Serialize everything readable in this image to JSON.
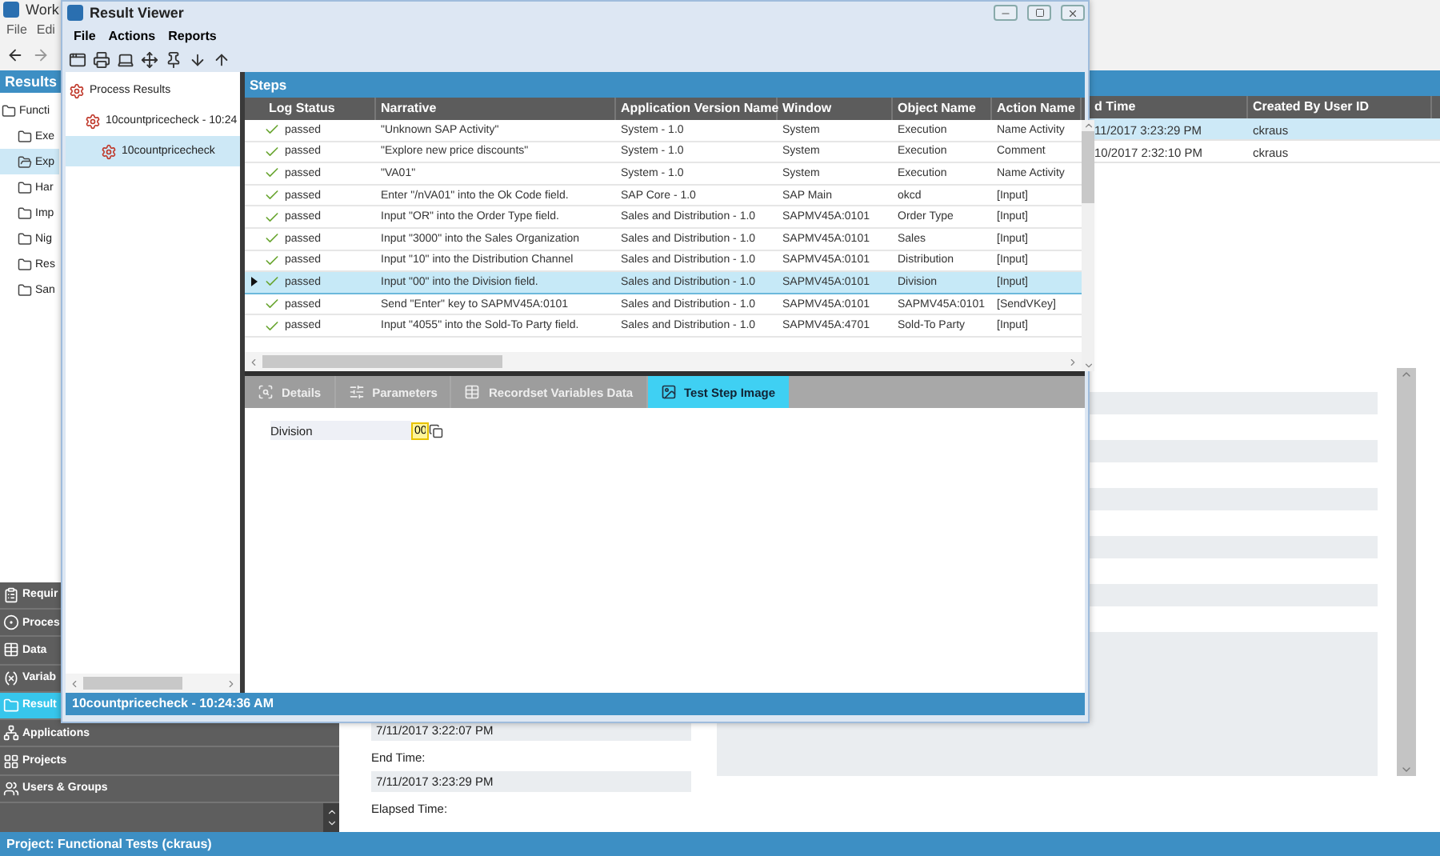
{
  "app": {
    "title": "Work",
    "menu": [
      "File",
      "Edi"
    ]
  },
  "results_panel": {
    "title": "Results",
    "tree": [
      {
        "label": "Functi",
        "selected": false,
        "children": [
          {
            "label": "Exe",
            "selected": false
          },
          {
            "label": "Exp",
            "selected": true
          },
          {
            "label": "Har",
            "selected": false
          },
          {
            "label": "Imp",
            "selected": false
          },
          {
            "label": "Nig",
            "selected": false
          },
          {
            "label": "Res",
            "selected": false
          },
          {
            "label": "San",
            "selected": false
          }
        ]
      }
    ]
  },
  "nav": [
    {
      "label": "Requir",
      "selected": false
    },
    {
      "label": "Proces",
      "selected": false
    },
    {
      "label": "Data",
      "selected": false
    },
    {
      "label": "Variab",
      "selected": false
    },
    {
      "label": "Result",
      "selected": true
    },
    {
      "label": "Applications",
      "selected": false
    },
    {
      "label": "Projects",
      "selected": false
    },
    {
      "label": "Users & Groups",
      "selected": false
    }
  ],
  "grid": {
    "columns": [
      "d Time",
      "Created By User ID"
    ],
    "rows": [
      {
        "cells": [
          "11/2017  3:23:29 PM",
          "ckraus"
        ],
        "selected": true
      },
      {
        "cells": [
          "10/2017  2:32:10 PM",
          "ckraus"
        ],
        "selected": false
      }
    ]
  },
  "details": [
    {
      "kind": "value",
      "text": "7/11/2017 3:22:07 PM"
    },
    {
      "kind": "label",
      "text": "End Time:"
    },
    {
      "kind": "value",
      "text": "7/11/2017 3:23:29 PM"
    },
    {
      "kind": "label",
      "text": "Elapsed Time:"
    }
  ],
  "status_bar": "Project: Functional Tests (ckraus)",
  "result_viewer": {
    "title": "Result Viewer",
    "menu": [
      "File",
      "Actions",
      "Reports"
    ],
    "tree": [
      {
        "label": "Process Results",
        "selected": false,
        "children": [
          {
            "label": "10countpricecheck - 10:24",
            "selected": false,
            "children": [
              {
                "label": "10countpricecheck",
                "selected": true
              }
            ]
          }
        ]
      }
    ],
    "steps": {
      "title": "Steps",
      "columns": [
        "Log Status",
        "Narrative",
        "Application Version Name",
        "Window",
        "Object Name",
        "Action Name"
      ],
      "rows": [
        {
          "passed": true,
          "cells": [
            "passed",
            "\"Unknown SAP Activity\"",
            "System - 1.0",
            "System",
            "Execution",
            "Name Activity"
          ],
          "selected": false
        },
        {
          "passed": true,
          "cells": [
            "passed",
            "\"Explore new price discounts\"",
            "System - 1.0",
            "System",
            "Execution",
            "Comment"
          ],
          "selected": false
        },
        {
          "passed": true,
          "cells": [
            "passed",
            "\"VA01\"",
            "System - 1.0",
            "System",
            "Execution",
            "Name Activity"
          ],
          "selected": false
        },
        {
          "passed": true,
          "cells": [
            "passed",
            "Enter \"/nVA01\" into the Ok Code field.",
            "SAP Core - 1.0",
            "SAP Main",
            "okcd",
            "[Input]"
          ],
          "selected": false
        },
        {
          "passed": true,
          "cells": [
            "passed",
            "Input \"OR\" into the Order Type field.",
            "Sales and Distribution - 1.0",
            "SAPMV45A:0101",
            "Order Type",
            "[Input]"
          ],
          "selected": false
        },
        {
          "passed": true,
          "cells": [
            "passed",
            "Input \"3000\" into the Sales Organization",
            "Sales and Distribution - 1.0",
            "SAPMV45A:0101",
            "Sales",
            "[Input]"
          ],
          "selected": false
        },
        {
          "passed": true,
          "cells": [
            "passed",
            "Input \"10\" into the Distribution Channel",
            "Sales and Distribution - 1.0",
            "SAPMV45A:0101",
            "Distribution",
            "[Input]"
          ],
          "selected": false
        },
        {
          "passed": true,
          "cells": [
            "passed",
            "Input \"00\" into the Division field.",
            "Sales and Distribution - 1.0",
            "SAPMV45A:0101",
            "Division",
            "[Input]"
          ],
          "selected": true
        },
        {
          "passed": true,
          "cells": [
            "passed",
            "Send \"Enter\" key to SAPMV45A:0101",
            "Sales and Distribution - 1.0",
            "SAPMV45A:0101",
            "SAPMV45A:0101",
            "[SendVKey]"
          ],
          "selected": false
        },
        {
          "passed": true,
          "cells": [
            "passed",
            "Input \"4055\" into the Sold-To Party field.",
            "Sales and Distribution - 1.0",
            "SAPMV45A:4701",
            "Sold-To Party",
            "[Input]"
          ],
          "selected": false
        }
      ]
    },
    "tabs": [
      {
        "label": "Details",
        "selected": false
      },
      {
        "label": "Parameters",
        "selected": false
      },
      {
        "label": "Recordset Variables Data",
        "selected": false
      },
      {
        "label": "Test Step Image",
        "selected": true
      }
    ],
    "image_fields": [
      {
        "label": "Division",
        "value": "00"
      }
    ],
    "status_bar": "10countpricecheck - 10:24:36 AM"
  }
}
